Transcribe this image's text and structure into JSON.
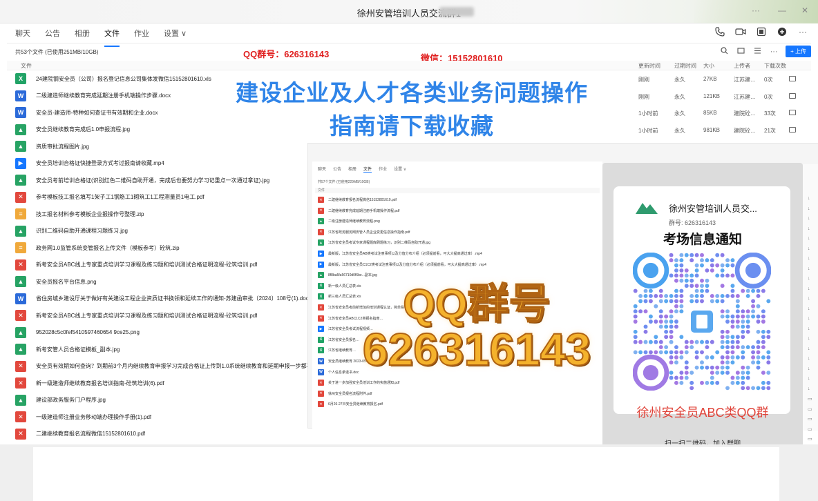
{
  "window": {
    "title": "徐州安管培训人员交流群1"
  },
  "tabs": [
    {
      "label": "聊天"
    },
    {
      "label": "公告"
    },
    {
      "label": "相册"
    },
    {
      "label": "文件"
    },
    {
      "label": "作业"
    },
    {
      "label": "设置 ∨"
    }
  ],
  "file_summary": "共53个文件 (已使用251MB/10GB)",
  "overlay": {
    "qq_contact": "QQ群号：626316143",
    "wechat_contact": "微信：15152801610",
    "banner_line1": "建设企业及人才各类业务问题操作",
    "banner_line2": "指南请下载收藏",
    "qq_big_line1": "QQ群号",
    "qq_big_line2": "626316143"
  },
  "toolbar": {
    "upload_label": "+ 上传"
  },
  "columns": {
    "file": "文件",
    "updated": "更新时间",
    "expiry": "过期时间",
    "size": "大小",
    "uploader": "上传者",
    "downloads": "下载次数"
  },
  "files": [
    {
      "type": "xls",
      "icon": "X",
      "name": "24建院钢安全员（公司）报名登记信息公司集体发微信15152801610.xls"
    },
    {
      "type": "doc",
      "icon": "W",
      "name": "二级建造师继续教育完成延期注册手机端操作步骤.docx"
    },
    {
      "type": "doc",
      "icon": "W",
      "name": "安全员-建造师-特种如何查证书有效期和企业.docx"
    },
    {
      "type": "jpg",
      "icon": "▲",
      "name": "安全员继续教育完成后1.0申报流程.jpg"
    },
    {
      "type": "jpg",
      "icon": "▲",
      "name": "资质审批流程图片.jpg"
    },
    {
      "type": "mp4",
      "icon": "▶",
      "name": "安全员培训合格证快捷登录方式考过报南请收藏.mp4"
    },
    {
      "type": "jpg",
      "icon": "▲",
      "name": "安全员考前培训合格证(识别红色二维码自助开通，完成后也要努力学习记重点一次通过拿证).jpg"
    },
    {
      "type": "pdf",
      "icon": "✕",
      "name": "参考模板技工报名填写1架子工1钢筋工1砌筑工1工程测量员1电工.pdf"
    },
    {
      "type": "zip",
      "icon": "≡",
      "name": "技工报名材料参考模板企业报操作号整理.zip"
    },
    {
      "type": "jpg",
      "icon": "▲",
      "name": "识别二维码自助开通课程习题练习.jpg"
    },
    {
      "type": "zip",
      "icon": "≡",
      "name": "政务网1.0监管系统变管报名上传文件（模板参考）砼筑.zip"
    },
    {
      "type": "pdf",
      "icon": "✕",
      "name": "新考安全员ABC线上专家重点培训学习课程及练习题和培训测试合格证明流程-砼筑培训.pdf"
    },
    {
      "type": "jpg",
      "icon": "▲",
      "name": "安全员报名平台信息.png"
    },
    {
      "type": "doc",
      "icon": "W",
      "name": "省住房城乡建设厅关于做好有关建设工程企业资质证书换领和延续工作的通知-苏建函审批〔2024〕108号(1).doc"
    },
    {
      "type": "pdf",
      "icon": "✕",
      "name": "新考安全员ABC线上专家重点培训学习课程及练习题和培训测试合格证明流程-砼筑培训.pdf"
    },
    {
      "type": "jpg",
      "icon": "▲",
      "name": "952028c5c0fef5410597460654 9ce25.png"
    },
    {
      "type": "jpg",
      "icon": "▲",
      "name": "新考安管人员合格证模板_副本.jpg"
    },
    {
      "type": "pdf",
      "icon": "✕",
      "name": "安全员有效期如何查询？到期前3个月内继续教育申报学习完成合格证上传到1.0系统继续教育和延期申报一步都不能少.pdf"
    },
    {
      "type": "pdf",
      "icon": "✕",
      "name": "新一级建造师继续教育报名培训指南-砼筑培训(6).pdf"
    },
    {
      "type": "jpg",
      "icon": "▲",
      "name": "建设部政务服务门户程序.jpg"
    },
    {
      "type": "pdf",
      "icon": "✕",
      "name": "一级建造师注册业务移动端办理操作手册(1).pdf"
    },
    {
      "type": "pdf",
      "icon": "✕",
      "name": "二建继续教育报名流程微信15152801610.pdf"
    }
  ],
  "file_meta": [
    {
      "updated": "刚刚",
      "expiry": "永久",
      "size": "27KB",
      "uploader": "江苏建…",
      "downloads": "0次"
    },
    {
      "updated": "刚刚",
      "expiry": "永久",
      "size": "121KB",
      "uploader": "江苏建…",
      "downloads": "0次"
    },
    {
      "updated": "1小时前",
      "expiry": "永久",
      "size": "85KB",
      "uploader": "建院砼…",
      "downloads": "33次"
    },
    {
      "updated": "1小时前",
      "expiry": "永久",
      "size": "981KB",
      "uploader": "建院砼…",
      "downloads": "21次"
    }
  ],
  "inner": {
    "tabs": [
      "聊天",
      "公告",
      "相册",
      "文件",
      "作业",
      "设置 ∨"
    ],
    "summary": "共57个文件 (已使用229MB/10GB)",
    "col": "文件",
    "files": [
      {
        "type": "pdf",
        "icon": "✕",
        "name": "二建继续教育报名流程微信15152801610.pdf"
      },
      {
        "type": "pdf",
        "icon": "✕",
        "name": "二建继续教育完成延期注册手机端操作流程.pdf"
      },
      {
        "type": "jpg",
        "icon": "▲",
        "name": "二级注册建造师继续教育流程.png"
      },
      {
        "type": "pdf",
        "icon": "✕",
        "name": "江苏省政务服务网安管人员企业变更信息操作指南.pdf"
      },
      {
        "type": "jpg",
        "icon": "▲",
        "name": "江苏省安全员考试专家课程题库刷题练习，识别二维码自助开通.jpg"
      },
      {
        "type": "mp4",
        "icon": "▶",
        "name": "最新版，江苏省安全员AB类考试注意事项以及分值分布介绍（必须提前看，可大大提高通过率）.mp4"
      },
      {
        "type": "mp4",
        "icon": "▶",
        "name": "最新版，江苏省安全员C1C2类考试注意事项以及分值分布介绍（必须提前看，可大大提高通过率）.mp4"
      },
      {
        "type": "jpg",
        "icon": "▲",
        "name": "8f8ba5fa56710d0f6be...副本.jpg"
      },
      {
        "type": "xls",
        "icon": "X",
        "name": "新一级人员汇总表.xls"
      },
      {
        "type": "xls",
        "icon": "X",
        "name": "新三级人员汇总表.xls"
      },
      {
        "type": "pdf",
        "icon": "✕",
        "name": "江苏省安全员考前新增加的培训课程认证，简单易学…"
      },
      {
        "type": "pdf",
        "icon": "✕",
        "name": "江苏省安全员ABC1C2类报名指南…"
      },
      {
        "type": "mp4",
        "icon": "▶",
        "name": "江苏省安全员考试流程视频…"
      },
      {
        "type": "xls",
        "icon": "X",
        "name": "江苏省安全员报名…"
      },
      {
        "type": "xls",
        "icon": "X",
        "name": "江苏省继续教育…"
      },
      {
        "type": "doc",
        "icon": "W",
        "name": "安全员继续教育 2023-05-08…"
      },
      {
        "type": "doc",
        "icon": "W",
        "name": "个人信息承诺书.doc"
      },
      {
        "type": "pdf",
        "icon": "✕",
        "name": "关于进一步加强安全员培训工作的实施通知.pdf"
      },
      {
        "type": "pdf",
        "icon": "✕",
        "name": "徐州安全员报名流程附件.pdf"
      },
      {
        "type": "pdf",
        "icon": "✕",
        "name": "6月26-27日安全员继续教育报名.pdf"
      }
    ]
  },
  "qr_card": {
    "group_name": "徐州安管培训人员交...",
    "group_number": "群号: 626316143",
    "notice": "考场信息通知",
    "group_caption": "徐州安全员ABC类QQ群",
    "scan_hint": "扫一扫二维码，加入群聊"
  },
  "colors": {
    "accent": "#1677ff",
    "banner": "#2f84e8",
    "warning_red": "#e02020",
    "qq_orange": "#f4b22c"
  }
}
